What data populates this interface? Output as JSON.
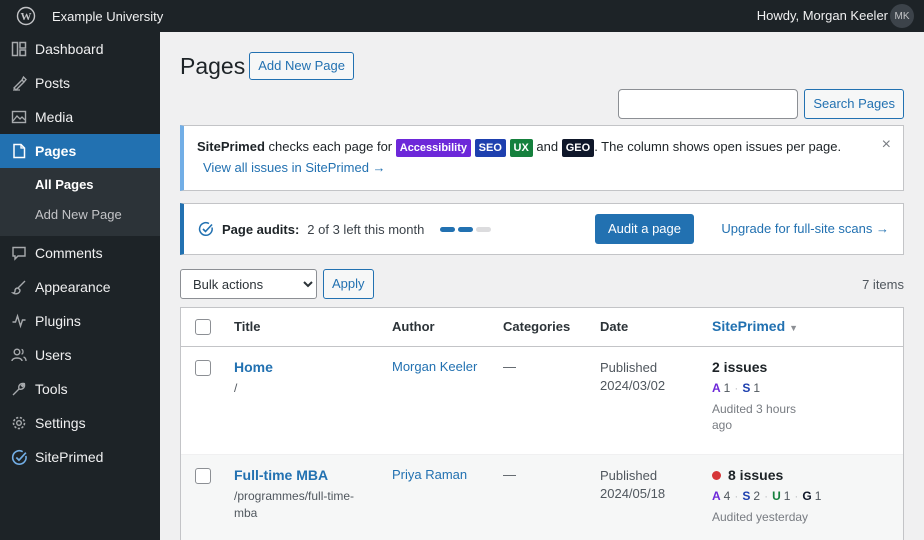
{
  "adminbar": {
    "site_name": "Example University",
    "howdy": "Howdy, Morgan Keeler",
    "avatar_initials": "MK"
  },
  "sidebar": {
    "items": [
      {
        "label": "Dashboard",
        "icon": "dashboard-icon"
      },
      {
        "label": "Posts",
        "icon": "pin-icon"
      },
      {
        "label": "Media",
        "icon": "media-icon"
      },
      {
        "label": "Pages",
        "icon": "page-icon",
        "current": true
      },
      {
        "label": "Comments",
        "icon": "comment-icon"
      },
      {
        "label": "Appearance",
        "icon": "brush-icon"
      },
      {
        "label": "Plugins",
        "icon": "plug-icon"
      },
      {
        "label": "Users",
        "icon": "users-icon"
      },
      {
        "label": "Tools",
        "icon": "wrench-icon"
      },
      {
        "label": "Settings",
        "icon": "gear-icon"
      },
      {
        "label": "SitePrimed",
        "icon": "siteprimed-check-icon"
      }
    ],
    "submenu": [
      {
        "label": "All Pages",
        "current": true
      },
      {
        "label": "Add New Page"
      }
    ]
  },
  "header": {
    "title": "Pages",
    "add_new": "Add New Page"
  },
  "search": {
    "value": "",
    "button": "Search Pages"
  },
  "notice": {
    "brand": "SitePrimed",
    "text1": "checks each page for",
    "tags": [
      {
        "label": "Accessibility",
        "color": "#6d28d9"
      },
      {
        "label": "SEO",
        "color": "#1e40af"
      },
      {
        "label": "UX",
        "color": "#15803d"
      },
      {
        "label": "GEO",
        "color": "#0f172a"
      }
    ],
    "and": "and",
    "text2": ". The column shows open issues per page.",
    "link": "View all issues in SitePrimed →",
    "dismiss": "×"
  },
  "audits": {
    "label": "Page audits:",
    "quota": "2 of 3 left this month",
    "used": 2,
    "total": 3,
    "button": "Audit a page",
    "upgrade": "Upgrade for full-site scans →"
  },
  "tablenav": {
    "bulk_selected": "Bulk actions",
    "apply": "Apply",
    "count": "7 items"
  },
  "table": {
    "columns": {
      "title": "Title",
      "author": "Author",
      "categories": "Categories",
      "date": "Date",
      "siteprimed": "SitePrimed"
    },
    "rows": [
      {
        "title": "Home",
        "slug": "/",
        "author": "Morgan Keeler",
        "categories": "—",
        "status": "Published",
        "date": "2024/03/02",
        "issues": "2 issues",
        "alert": false,
        "codes": [
          {
            "code": "A",
            "count": "1",
            "color": "#6d28d9"
          },
          {
            "code": "S",
            "count": "1",
            "color": "#1e40af"
          }
        ],
        "audited": "Audited 3 hours ago"
      },
      {
        "title": "Full-time MBA",
        "slug": "/programmes/full-time-mba",
        "author": "Priya Raman",
        "categories": "—",
        "status": "Published",
        "date": "2024/05/18",
        "issues": "8 issues",
        "alert": true,
        "codes": [
          {
            "code": "A",
            "count": "4",
            "color": "#6d28d9"
          },
          {
            "code": "S",
            "count": "2",
            "color": "#1e40af"
          },
          {
            "code": "U",
            "count": "1",
            "color": "#15803d"
          },
          {
            "code": "G",
            "count": "1",
            "color": "#0f172a"
          }
        ],
        "audited": "Audited yesterday"
      }
    ]
  }
}
